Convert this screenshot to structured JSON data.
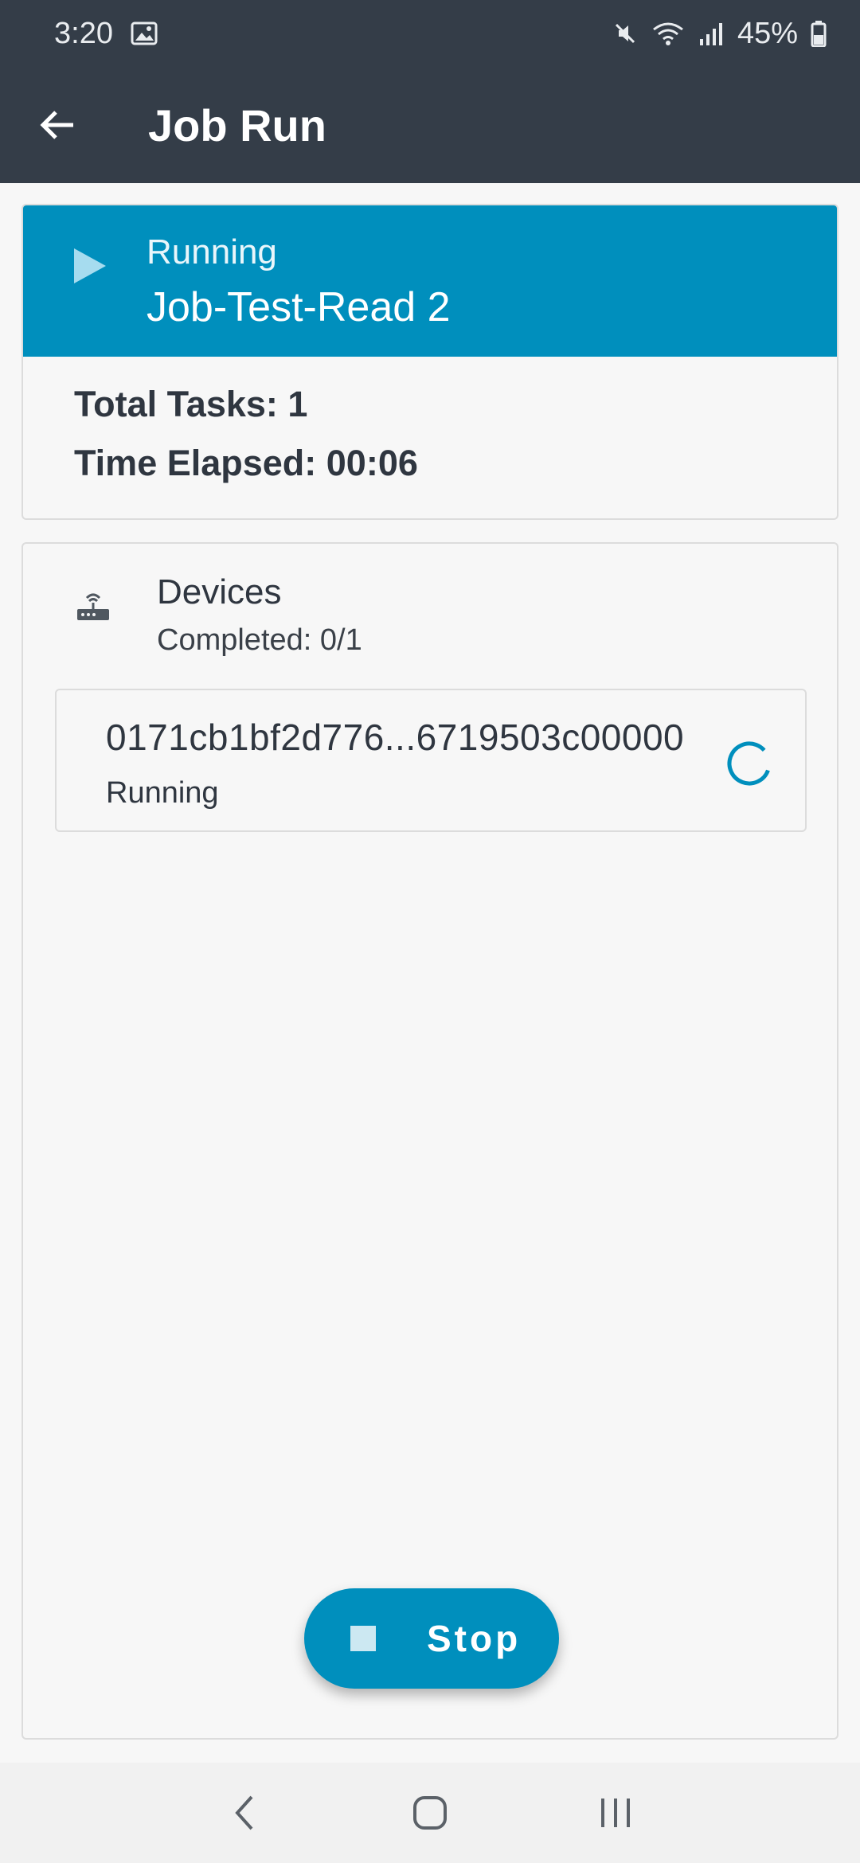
{
  "status_bar": {
    "time": "3:20",
    "battery": "45%",
    "icons": [
      "image-icon",
      "mute-icon",
      "wifi-icon",
      "signal-icon",
      "battery-icon"
    ]
  },
  "app_bar": {
    "title": "Job Run",
    "back_icon": "arrow-left-icon"
  },
  "job": {
    "status": "Running",
    "name": "Job-Test-Read 2",
    "total_tasks": "Total Tasks: 1",
    "time_elapsed": "Time Elapsed: 00:06"
  },
  "devices": {
    "title": "Devices",
    "completed": "Completed: 0/1",
    "items": [
      {
        "id": "0171cb1bf2d776...6719503c00000",
        "state": "Running"
      }
    ]
  },
  "stop_button": {
    "label": "Stop"
  },
  "colors": {
    "app_bar": "#343d48",
    "accent": "#008fbd",
    "background": "#f7f7f7"
  }
}
